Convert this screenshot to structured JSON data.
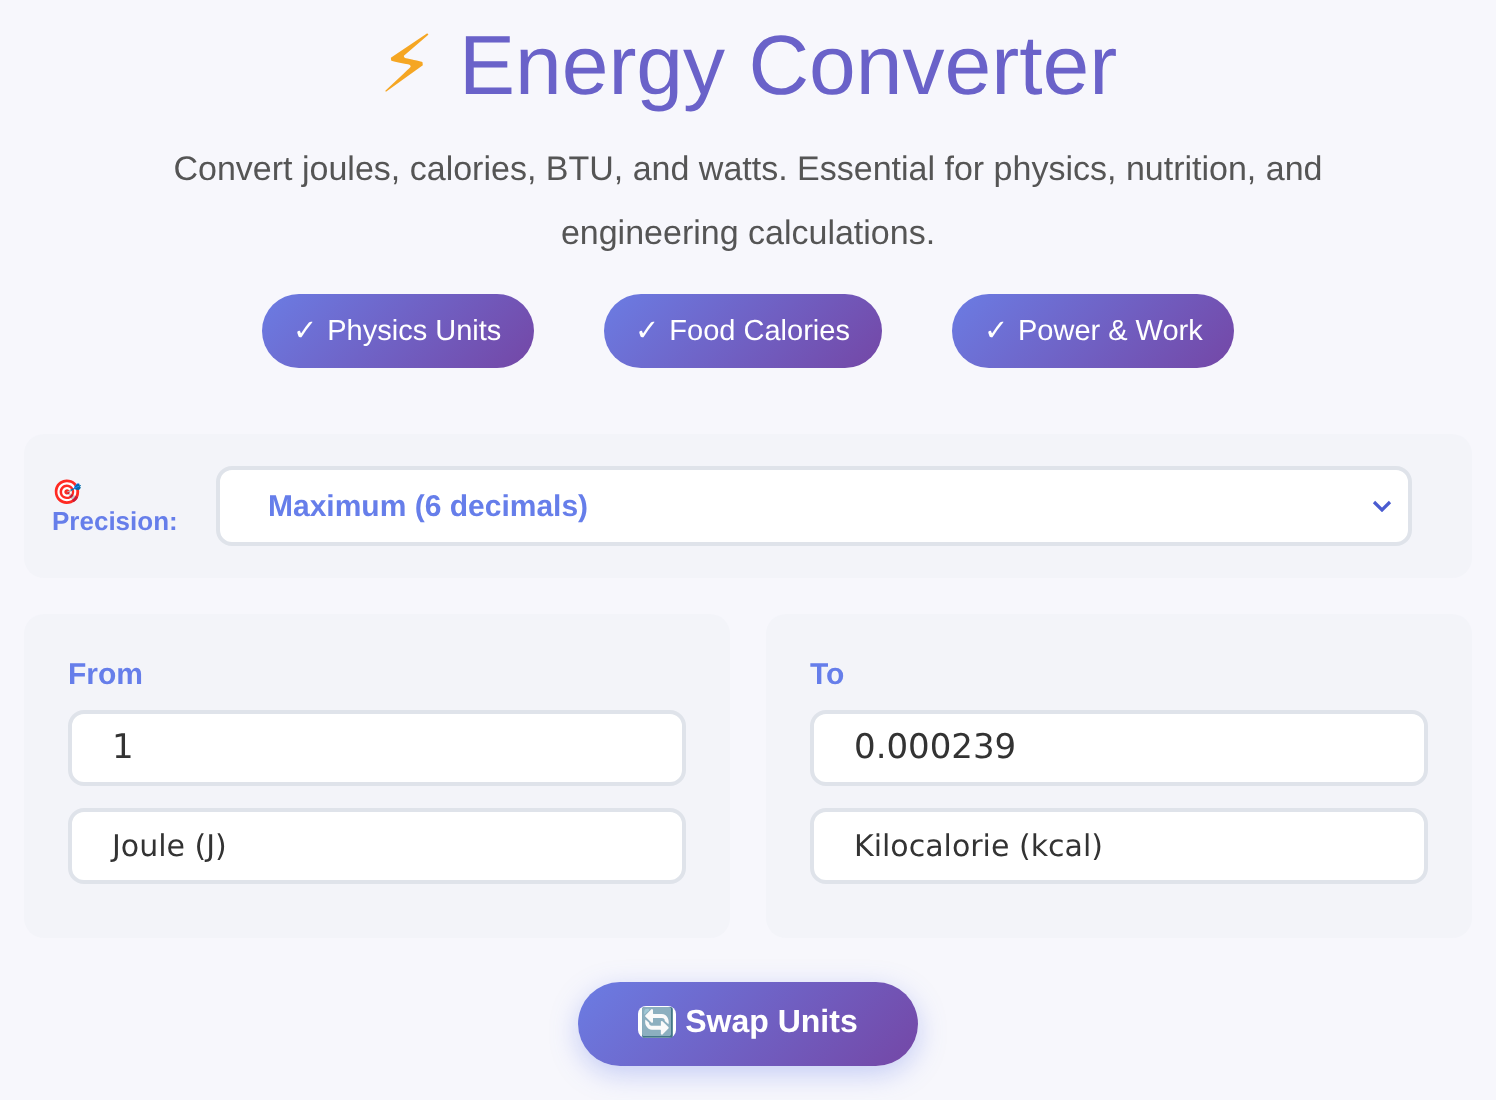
{
  "header": {
    "icon": "⚡",
    "title": "Energy Converter",
    "subtitle": "Convert joules, calories, BTU, and watts. Essential for physics, nutrition, and engineering calculations."
  },
  "badges": [
    "✓ Physics Units",
    "✓ Food Calories",
    "✓ Power & Work"
  ],
  "precision": {
    "icon": "🎯",
    "label": "Precision:",
    "value": "Maximum (6 decimals)"
  },
  "panels": [
    {
      "label": "From",
      "value": "1",
      "unit": "Joule (J)"
    },
    {
      "label": "To",
      "value": "0.000239",
      "unit": "Kilocalorie (kcal)"
    }
  ],
  "swap_button": {
    "icon": "🔄",
    "label": "Swap Units"
  }
}
